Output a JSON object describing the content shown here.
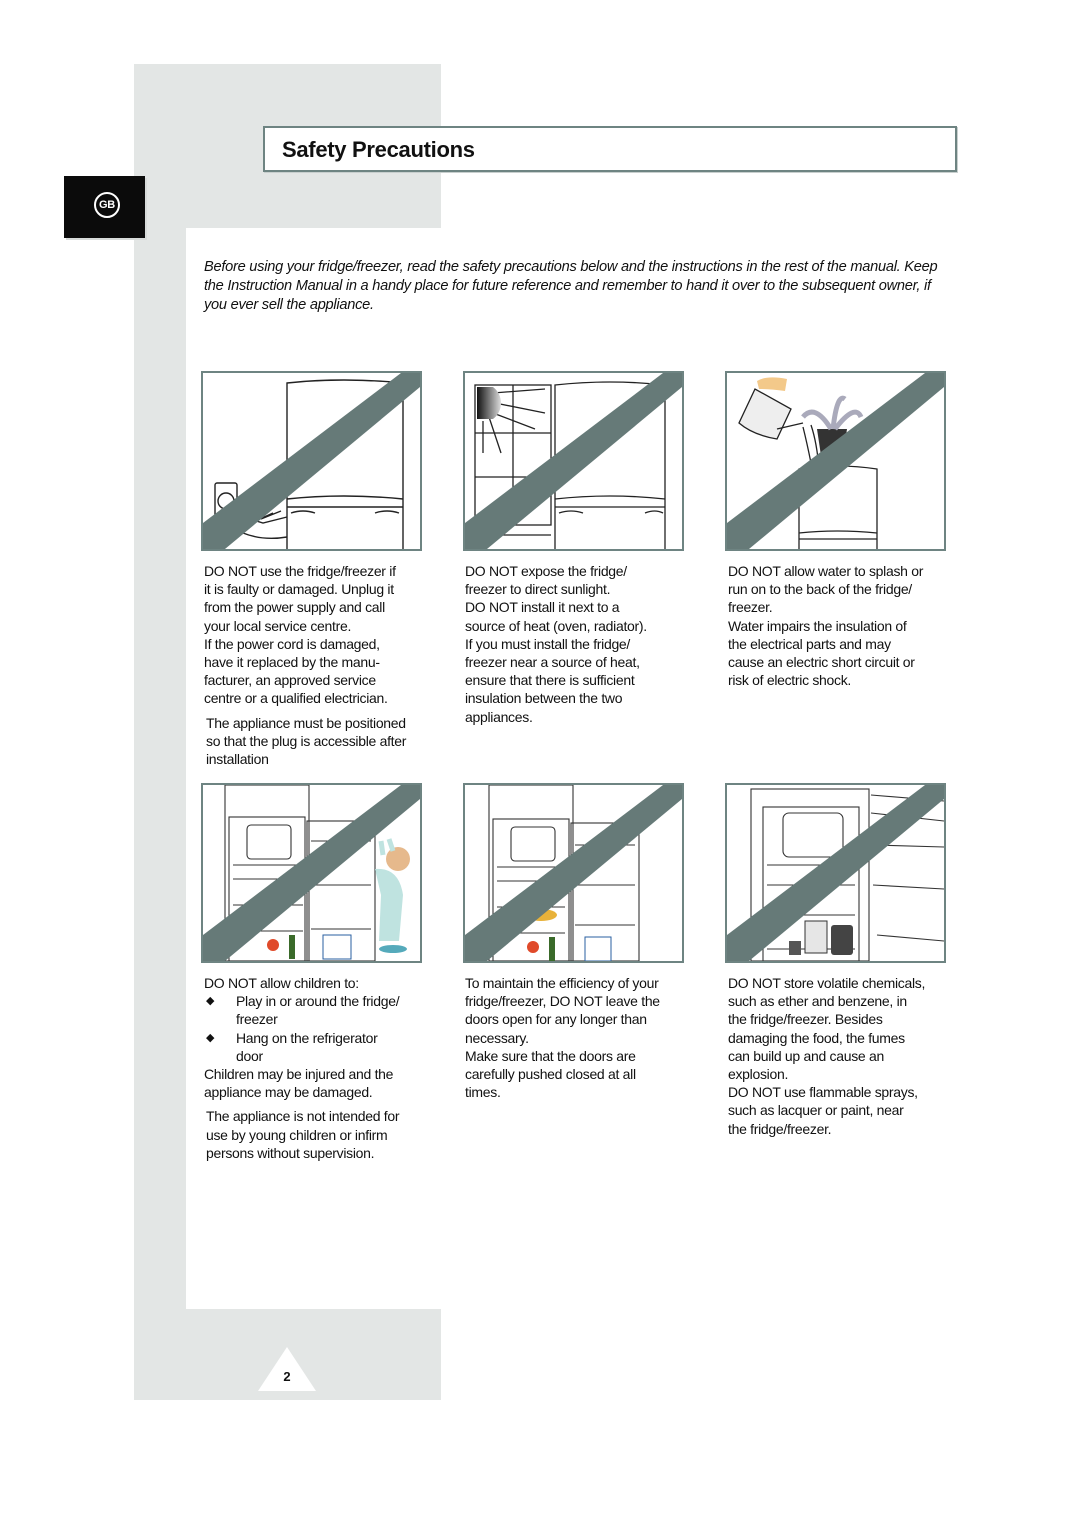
{
  "header": {
    "title": "Safety Precautions",
    "language_badge": "GB"
  },
  "intro": "Before using your fridge/freezer, read the safety precautions below and the instructions in the rest of the manual. Keep the Instruction Manual in a handy place for future reference and remember to hand it over to the subsequent owner, if you ever sell the appliance.",
  "colors": {
    "accent_gray": "#6e8482",
    "slash": "#667a78",
    "background_band": "#e3e6e5",
    "badge": "#0b0b0b"
  },
  "illustrations": [
    {
      "icon": "unplug-damaged-fridge-icon"
    },
    {
      "icon": "sunlight-window-fridge-icon"
    },
    {
      "icon": "watering-plant-on-fridge-icon"
    },
    {
      "icon": "child-climbing-fridge-icon"
    },
    {
      "icon": "fridge-doors-open-icon"
    },
    {
      "icon": "chemicals-in-fridge-icon"
    }
  ],
  "sections": [
    {
      "lines": [
        "DO NOT use the fridge/freezer if",
        "it is faulty or damaged. Unplug it",
        "from the power supply and call",
        "your local service centre.",
        "If the power cord is damaged,",
        "have it replaced by the manu-",
        "facturer, an approved service",
        "centre or a qualified electrician."
      ],
      "note": [
        "The appliance must be positioned",
        "so that the plug is accessible after",
        "installation"
      ]
    },
    {
      "lines": [
        "DO NOT expose the fridge/",
        "freezer to direct sunlight.",
        "DO NOT install it next to a",
        "source of heat (oven, radiator).",
        "If you must install the fridge/",
        "freezer near a source of heat,",
        "ensure that there is sufficient",
        "insulation between the two",
        "appliances."
      ]
    },
    {
      "lines": [
        "DO NOT allow water to splash or",
        "run on to the back of the fridge/",
        "freezer.",
        "Water impairs the insulation of",
        "the electrical parts and may",
        "cause an electric short circuit or",
        "risk of electric shock."
      ]
    },
    {
      "lead": "DO NOT allow children to:",
      "bullets": [
        {
          "mark": "◆",
          "line1": "Play in or around the fridge/",
          "line2": "freezer"
        },
        {
          "mark": "◆",
          "line1": "Hang on the refrigerator",
          "line2": "door"
        }
      ],
      "lines": [
        "Children may be injured and the",
        "appliance may be damaged."
      ],
      "note": [
        "The appliance is not intended for",
        "use by young children or infirm",
        "persons without supervision."
      ]
    },
    {
      "lines": [
        "To maintain the efficiency of your",
        "fridge/freezer, DO NOT leave the",
        "doors open for any longer than",
        "necessary.",
        "Make sure that the doors are",
        "carefully pushed closed at all",
        "times."
      ]
    },
    {
      "lines": [
        "DO NOT store volatile chemicals,",
        "such as ether and benzene, in",
        "the fridge/freezer. Besides",
        "damaging the food, the fumes",
        "can build up and cause an",
        "explosion.",
        "DO NOT use flammable sprays,",
        "such as lacquer or paint, near",
        "the fridge/freezer."
      ]
    }
  ],
  "footer": {
    "page_number": "2"
  }
}
